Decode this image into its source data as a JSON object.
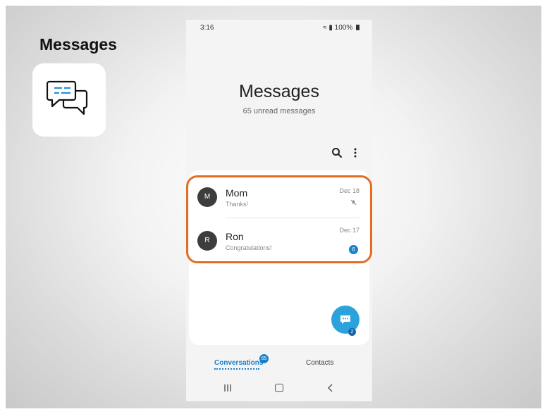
{
  "slide": {
    "title": "Messages",
    "app_icon": "chat-bubbles-icon"
  },
  "status_bar": {
    "time": "3:16",
    "battery": "100%"
  },
  "header": {
    "title": "Messages",
    "subtitle": "65 unread messages"
  },
  "toolbar": {
    "search_icon": "search-icon",
    "more_icon": "more-vertical-icon"
  },
  "conversations": [
    {
      "avatar_letter": "M",
      "name": "Mom",
      "preview": "Thanks!",
      "date": "Dec 18",
      "status_icon": "mute-icon"
    },
    {
      "avatar_letter": "R",
      "name": "Ron",
      "preview": "Congratulations!",
      "date": "Dec 17",
      "unread_count": "6"
    }
  ],
  "fab": {
    "icon": "compose-message-icon",
    "badge": "2"
  },
  "tabs": {
    "conversations_label": "Conversations",
    "conversations_badge": "65",
    "contacts_label": "Contacts"
  },
  "colors": {
    "accent": "#1a7fc9",
    "highlight": "#e36d22",
    "fab": "#2aa3dd"
  }
}
